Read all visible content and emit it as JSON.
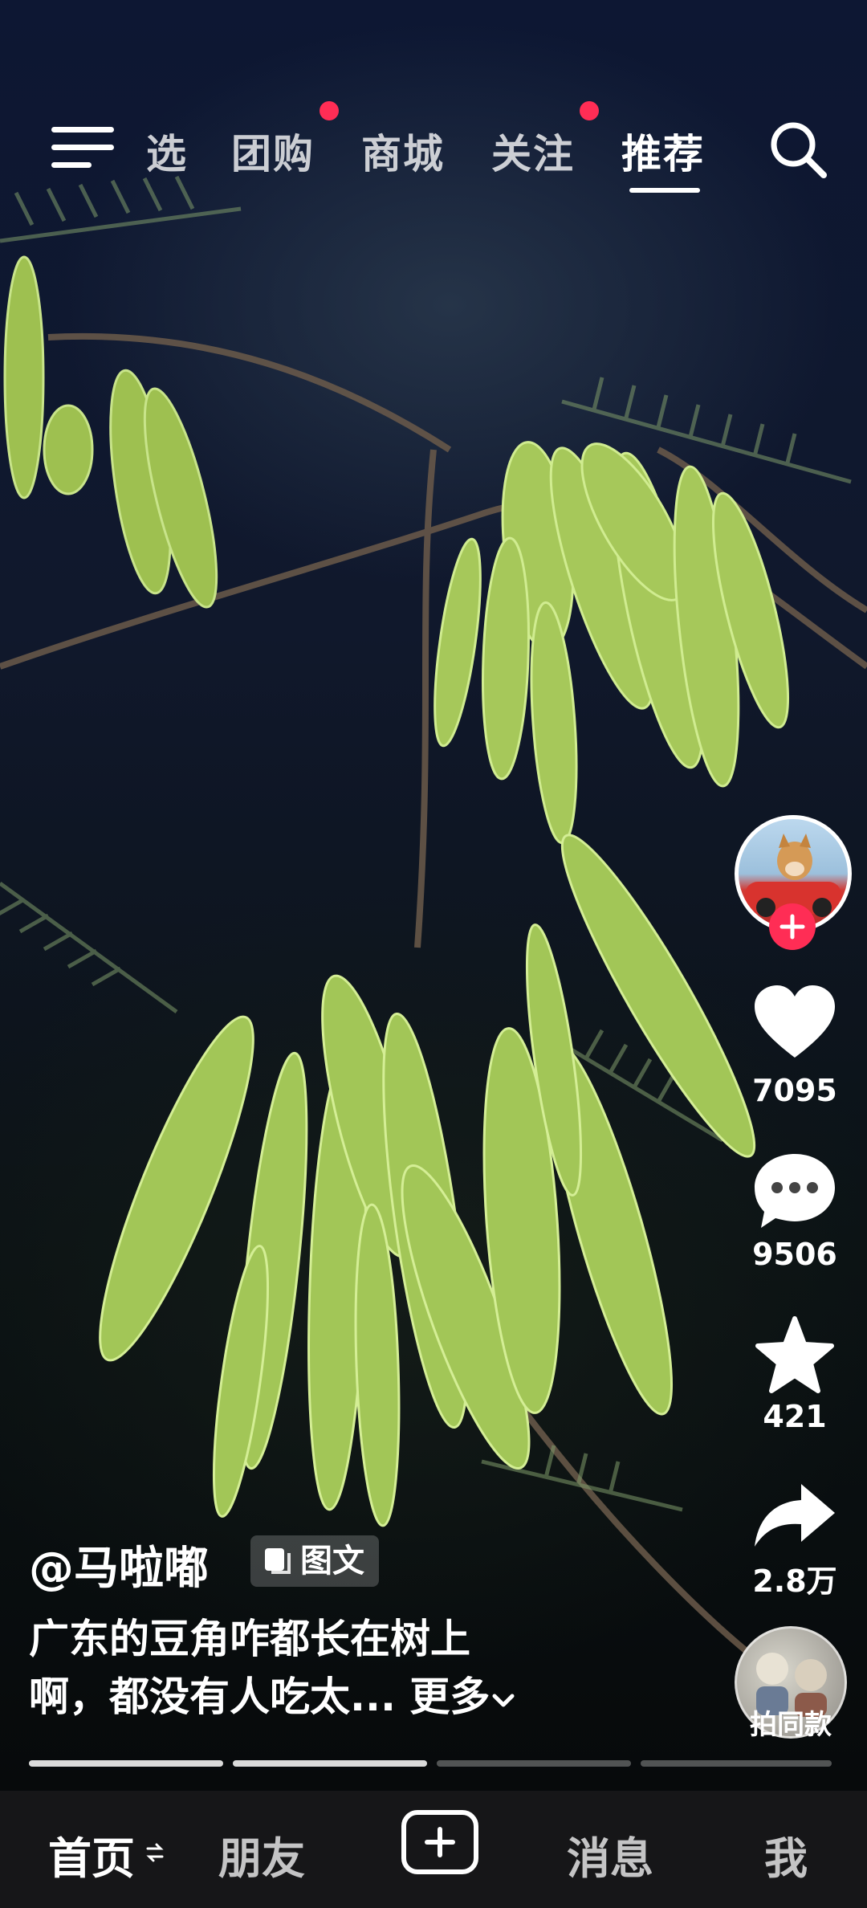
{
  "top_nav": {
    "tabs": [
      {
        "label": "选"
      },
      {
        "label": "团购"
      },
      {
        "label": "商城"
      },
      {
        "label": "关注"
      },
      {
        "label": "推荐"
      }
    ],
    "active_tab": "推荐"
  },
  "right_rail": {
    "likes": "7095",
    "comments": "9506",
    "favorites": "421",
    "shares": "2.8万",
    "same_style_label": "拍同款"
  },
  "post": {
    "author": "@马啦嘟",
    "type_badge": "图文",
    "caption_line1": "广东的豆角咋都长在树上",
    "caption_line2": "啊，都没有人吃太...",
    "more_label": "更多"
  },
  "bottom_bar": {
    "home": "首页",
    "friends": "朋友",
    "messages": "消息",
    "me": "我"
  },
  "colors": {
    "accent_red": "#ff2d55",
    "pod_green": "#a8cc55"
  },
  "icons": [
    "menu-icon",
    "search-icon",
    "heart-icon",
    "comment-icon",
    "star-icon",
    "share-icon",
    "plus-icon",
    "image-text-icon",
    "chevron-down-icon",
    "swap-icon"
  ]
}
